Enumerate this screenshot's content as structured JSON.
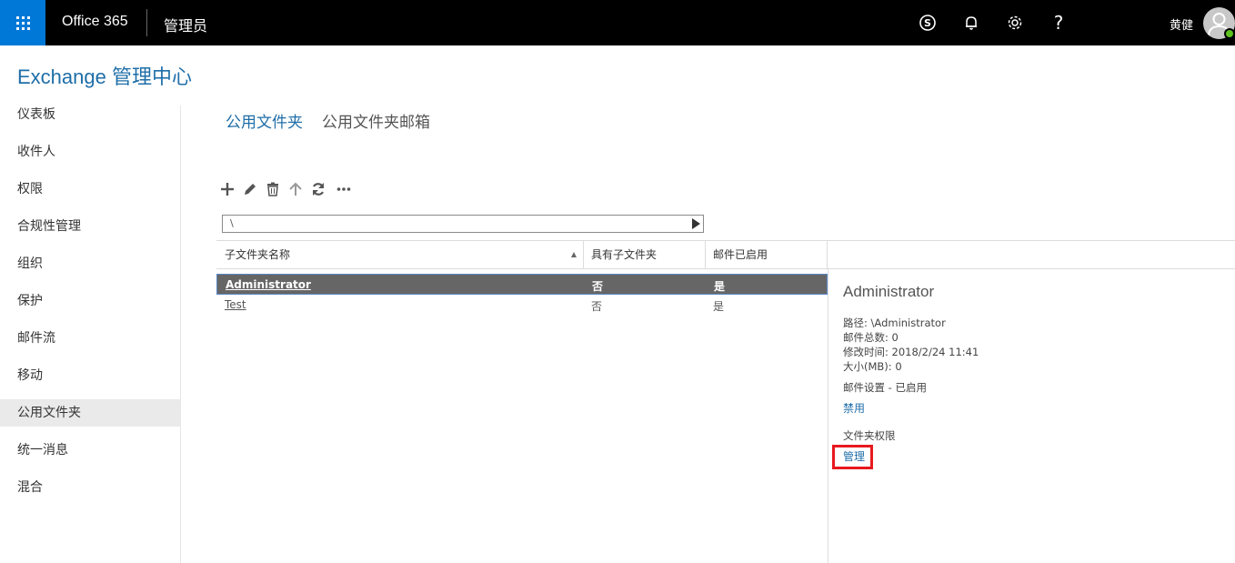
{
  "topbar": {
    "brand": "Office 365",
    "app_name": "管理员",
    "user_name": "黄健",
    "colors": {
      "waffle_bg": "#0078d7",
      "bar_bg": "#000000",
      "presence": "#5dc21e"
    },
    "icons": [
      "app-launcher-icon",
      "skype-icon",
      "bell-icon",
      "gear-icon",
      "help-icon",
      "avatar-icon"
    ],
    "help_glyph": "?"
  },
  "page_title": "Exchange 管理中心",
  "sidebar": {
    "items": [
      {
        "label": "仪表板"
      },
      {
        "label": "收件人"
      },
      {
        "label": "权限"
      },
      {
        "label": "合规性管理"
      },
      {
        "label": "组织"
      },
      {
        "label": "保护"
      },
      {
        "label": "邮件流"
      },
      {
        "label": "移动"
      },
      {
        "label": "公用文件夹",
        "active": true
      },
      {
        "label": "统一消息"
      },
      {
        "label": "混合"
      }
    ]
  },
  "subtabs": {
    "active": "公用文件夹",
    "inactive": "公用文件夹邮箱"
  },
  "toolbar": {
    "icons": [
      "add-icon",
      "edit-icon",
      "delete-icon",
      "up-arrow-icon",
      "refresh-icon",
      "more-icon"
    ]
  },
  "path": {
    "value": "\\"
  },
  "table": {
    "columns": [
      "子文件夹名称",
      "具有子文件夹",
      "邮件已启用"
    ],
    "sort": {
      "column": "子文件夹名称",
      "direction": "ascending"
    },
    "rows": [
      {
        "name": "Administrator",
        "has_subfolders": "否",
        "mail_enabled": "是",
        "selected": true
      },
      {
        "name": "Test",
        "has_subfolders": "否",
        "mail_enabled": "是",
        "selected": false
      }
    ]
  },
  "details": {
    "title": "Administrator",
    "path": "路径: \\Administrator",
    "total_items": "邮件总数: 0",
    "modified": "修改时间: 2018/2/24 11:41",
    "size": "大小(MB): 0",
    "mail_settings": "邮件设置 - 已启用",
    "disable_link": "禁用",
    "folder_permissions": "文件夹权限",
    "manage_link": "管理",
    "highlight_color": "#e8191e"
  }
}
